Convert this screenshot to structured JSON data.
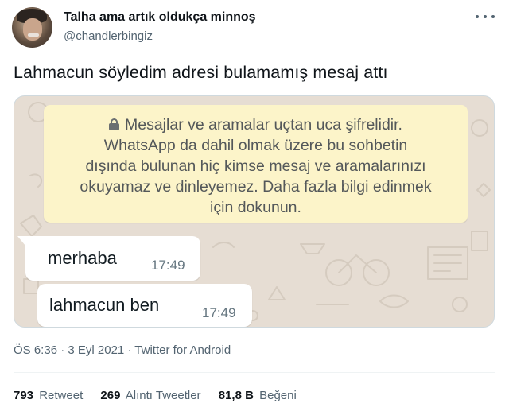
{
  "tweet": {
    "author_name": "Talha ama artık oldukça minnoş",
    "author_handle": "@chandlerbingiz",
    "text": "Lahmacun söyledim adresi bulamamış mesaj attı",
    "meta": "ÖS 6:36 · 3 Eyl 2021 · Twitter for Android",
    "stats": [
      {
        "count": "793",
        "label": "Retweet"
      },
      {
        "count": "269",
        "label": "Alıntı Tweetler"
      },
      {
        "count": "81,8 B",
        "label": "Beğeni"
      }
    ]
  },
  "whatsapp": {
    "encryption_notice_lines": [
      "Mesajlar ve aramalar uçtan uca şifrelidir.",
      "WhatsApp da dahil olmak üzere bu sohbetin",
      "dışında bulunan hiç kimse mesaj ve aramalarınızı",
      "okuyamaz ve dinleyemez. Daha fazla bilgi edinmek",
      "için dokunun."
    ],
    "messages": [
      {
        "text": "merhaba",
        "time": "17:49"
      },
      {
        "text": "lahmacun ben",
        "time": "17:49"
      }
    ],
    "colors": {
      "chat_background": "#e6ddd3",
      "notice_background": "#fcf4c9",
      "bubble_background": "#ffffff"
    }
  },
  "icons": [
    "avatar",
    "more-icon",
    "lock-icon"
  ]
}
